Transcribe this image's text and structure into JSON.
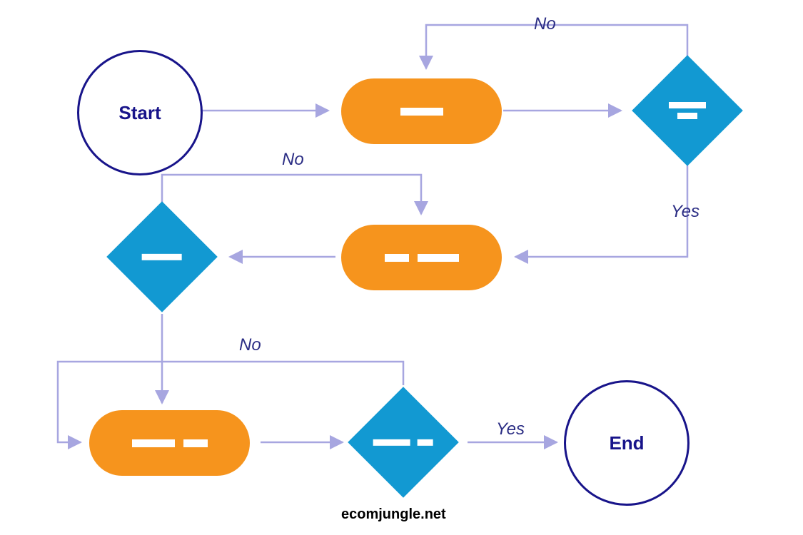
{
  "nodes": {
    "start": {
      "label": "Start"
    },
    "end": {
      "label": "End"
    }
  },
  "edges": {
    "d1_no": "No",
    "d1_yes": "Yes",
    "d2_no": "No",
    "d3_no": "No",
    "d3_yes": "Yes"
  },
  "attribution": "ecomjungle.net",
  "colors": {
    "process": "#f6941d",
    "decision": "#1299d2",
    "terminal_border": "#18148a",
    "arrow": "#a7a6e0",
    "label": "#2b2d84"
  },
  "chart_data": {
    "type": "flowchart",
    "nodes": [
      {
        "id": "start",
        "kind": "terminal",
        "label": "Start"
      },
      {
        "id": "p1",
        "kind": "process",
        "label": ""
      },
      {
        "id": "d1",
        "kind": "decision",
        "label": ""
      },
      {
        "id": "p2",
        "kind": "process",
        "label": ""
      },
      {
        "id": "d2",
        "kind": "decision",
        "label": ""
      },
      {
        "id": "p3",
        "kind": "process",
        "label": ""
      },
      {
        "id": "d3",
        "kind": "decision",
        "label": ""
      },
      {
        "id": "end",
        "kind": "terminal",
        "label": "End"
      }
    ],
    "edges": [
      {
        "from": "start",
        "to": "p1",
        "label": ""
      },
      {
        "from": "p1",
        "to": "d1",
        "label": ""
      },
      {
        "from": "d1",
        "to": "p1",
        "label": "No"
      },
      {
        "from": "d1",
        "to": "p2",
        "label": "Yes"
      },
      {
        "from": "p2",
        "to": "d2",
        "label": ""
      },
      {
        "from": "d2",
        "to": "p2",
        "label": "No"
      },
      {
        "from": "d2",
        "to": "p3",
        "label": ""
      },
      {
        "from": "p3",
        "to": "d3",
        "label": ""
      },
      {
        "from": "d3",
        "to": "p3",
        "label": "No"
      },
      {
        "from": "d3",
        "to": "end",
        "label": "Yes"
      }
    ]
  }
}
